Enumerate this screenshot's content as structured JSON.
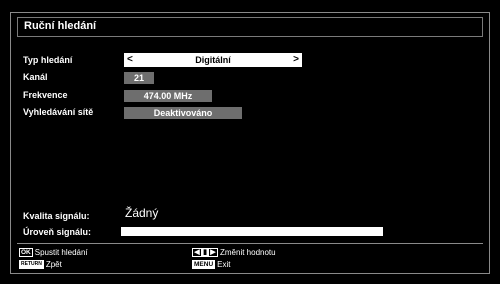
{
  "title": "Ruční hledání",
  "rows": {
    "search_type_label": "Typ hledání",
    "search_type_value": "Digitální",
    "channel_label": "Kanál",
    "channel_value": "21",
    "frequency_label": "Frekvence",
    "frequency_value": "474.00 MHz",
    "network_search_label": "Vyhledávání sítě",
    "network_search_value": "Deaktivováno"
  },
  "signal": {
    "quality_label": "Kvalita signálu:",
    "quality_value": "Žádný",
    "level_label": "Úroveň signálu:",
    "level_fraction": 1.0
  },
  "footer": {
    "ok_key": "OK",
    "start_search": "Spustit hledání",
    "return_key": "RETURN",
    "back": "Zpět",
    "change_value": "Změnit hodnotu",
    "menu_key": "MENU",
    "exit": "Exit"
  },
  "colors": {
    "field_gray": "#6e6e6e",
    "border_gray": "#8a8a8a",
    "background": "#000000"
  }
}
